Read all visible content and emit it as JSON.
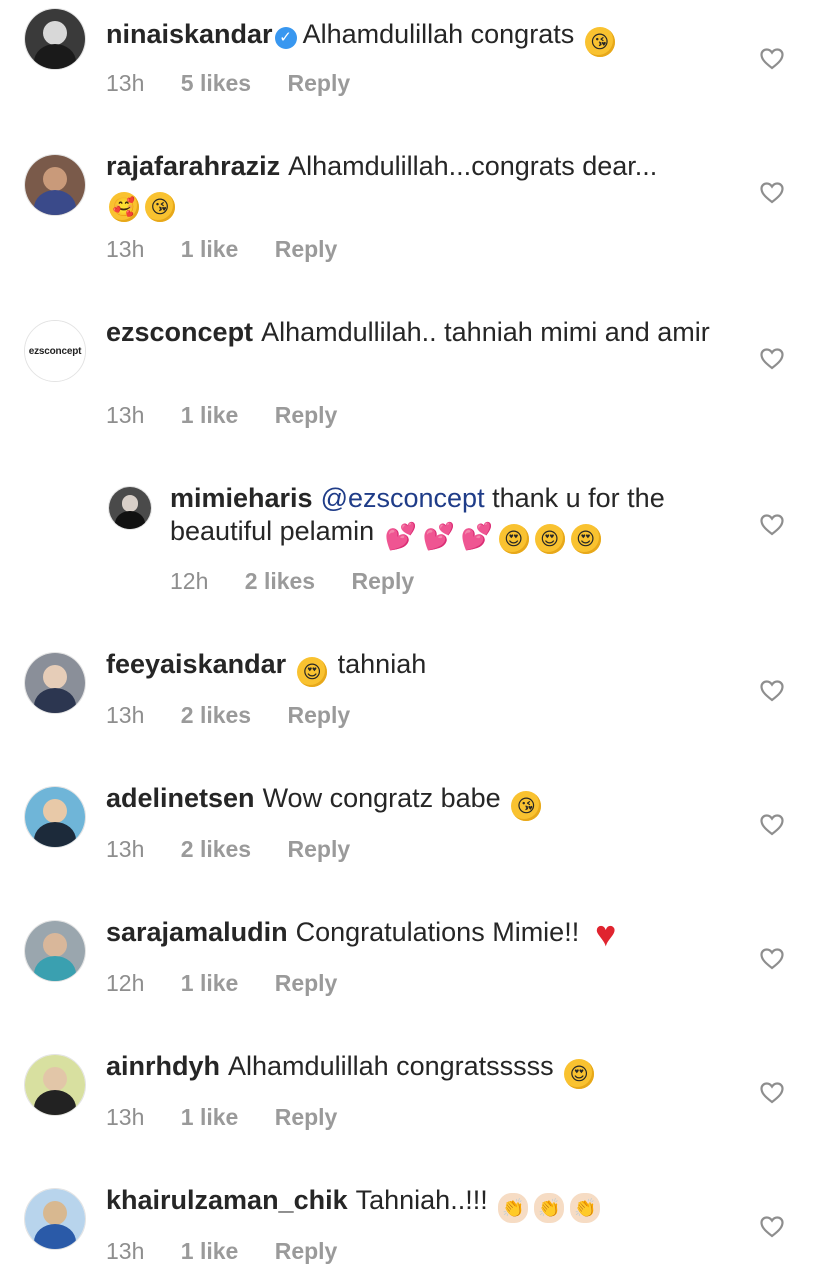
{
  "comments": [
    {
      "username": "ninaiskandar",
      "verified": true,
      "text": "Alhamdulillah congrats",
      "emojis": [
        "kiss-face"
      ],
      "time": "13h",
      "likes": "5 likes",
      "reply": "Reply"
    },
    {
      "username": "rajafarahraziz",
      "text": "Alhamdulillah...congrats dear...",
      "emojis": [
        "smiling-hearts-face",
        "kiss-face"
      ],
      "time": "13h",
      "likes": "1 like",
      "reply": "Reply"
    },
    {
      "username": "ezsconcept",
      "text": "Alhamdullilah.. tahniah mimi and amir",
      "avatar_text": "ezsconcept",
      "time": "13h",
      "likes": "1 like",
      "reply": "Reply"
    },
    {
      "username": "mimieharis",
      "mention": "@ezsconcept",
      "text": "thank u for the beautiful pelamin",
      "emojis": [
        "two-hearts",
        "two-hearts",
        "two-hearts",
        "heart-eyes-face",
        "heart-eyes-face",
        "heart-eyes-face"
      ],
      "time": "12h",
      "likes": "2 likes",
      "reply": "Reply"
    },
    {
      "username": "feeyaiskandar",
      "text": "tahniah",
      "emojis_before": [
        "heart-eyes-face"
      ],
      "time": "13h",
      "likes": "2 likes",
      "reply": "Reply"
    },
    {
      "username": "adelinetsen",
      "text": "Wow congratz babe",
      "emojis": [
        "kiss-face"
      ],
      "time": "13h",
      "likes": "2 likes",
      "reply": "Reply"
    },
    {
      "username": "sarajamaludin",
      "text": "Congratulations Mimie!!",
      "emojis": [
        "red-heart"
      ],
      "time": "12h",
      "likes": "1 like",
      "reply": "Reply"
    },
    {
      "username": "ainrhdyh",
      "text": "Alhamdulillah congratsssss",
      "emojis": [
        "heart-eyes-face"
      ],
      "time": "13h",
      "likes": "1 like",
      "reply": "Reply"
    },
    {
      "username": "khairulzaman_chik",
      "text": "Tahniah..!!!",
      "emojis": [
        "clapping-hands",
        "clapping-hands",
        "clapping-hands"
      ],
      "time": "13h",
      "likes": "1 like",
      "reply": "Reply"
    }
  ],
  "icons": {
    "like": "heart-outline-icon",
    "verified": "verified-badge-icon"
  },
  "colors": {
    "text": "#262626",
    "meta": "#8e8e8e",
    "mention": "#1f3c88",
    "verified": "#3897f0"
  }
}
